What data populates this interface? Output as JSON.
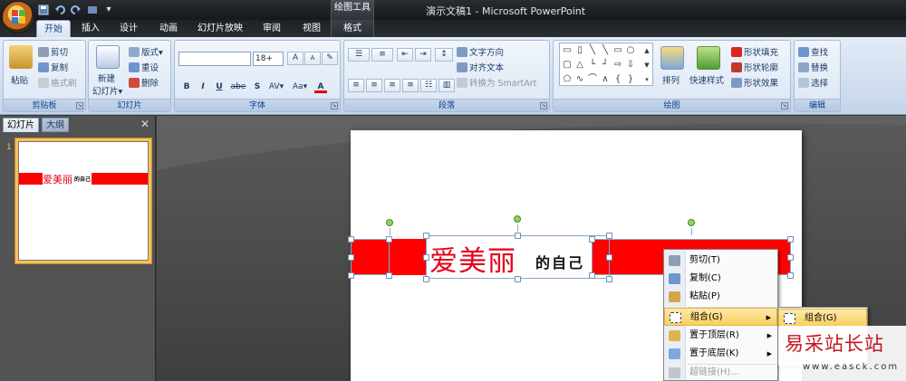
{
  "titlebar": {
    "app_title": "演示文稿1 - Microsoft PowerPoint",
    "context_tool": "绘图工具",
    "qat_icons": [
      "save-icon",
      "undo-icon",
      "redo-icon",
      "customize-icon"
    ],
    "qat_more": "▾"
  },
  "tabs": [
    "开始",
    "插入",
    "设计",
    "动画",
    "幻灯片放映",
    "审阅",
    "视图"
  ],
  "context_tab": "格式",
  "ribbon": {
    "clipboard": {
      "label": "剪贴板",
      "paste": "粘贴",
      "cut": "剪切",
      "copy": "复制",
      "format_painter": "格式刷"
    },
    "slides": {
      "label": "幻灯片",
      "new_slide_1": "新建",
      "new_slide_2": "幻灯片▾",
      "layout": "版式▾",
      "reset": "重设",
      "delete": "删除"
    },
    "font": {
      "label": "字体",
      "font_name": "",
      "font_size": "18+",
      "grow": "A",
      "shrink": "A",
      "bold": "B",
      "italic": "I",
      "underline": "U",
      "strike": "abe",
      "shadow": "S",
      "spacing": "AV▾",
      "case": "Aa▾",
      "color": "A"
    },
    "paragraph": {
      "label": "段落",
      "text_direction": "文字方向",
      "align_text": "对齐文本",
      "smartart": "转换为 SmartArt"
    },
    "drawing": {
      "label": "绘图",
      "arrange": "排列",
      "quick_styles": "快速样式",
      "shape_fill": "形状填充",
      "shape_outline": "形状轮廓",
      "shape_effects": "形状效果"
    },
    "editing": {
      "label": "编辑",
      "find": "查找",
      "replace": "替换",
      "select": "选择"
    }
  },
  "left_panel": {
    "tab_slides": "幻灯片",
    "tab_outline": "大纲",
    "close": "✕",
    "slide_number": "1",
    "thumb_big": "爱美丽",
    "thumb_small": "的自己"
  },
  "slide": {
    "text_big": "爱美丽",
    "text_small": "的自己"
  },
  "context_menu": {
    "items": [
      {
        "label": "剪切(T)",
        "icon": "scissors-icon",
        "arrow": ""
      },
      {
        "label": "复制(C)",
        "icon": "copy-icon",
        "arrow": ""
      },
      {
        "label": "粘贴(P)",
        "icon": "paste-icon",
        "arrow": ""
      },
      {
        "label": "组合(G)",
        "icon": "group-icon",
        "arrow": "▶"
      },
      {
        "label": "置于顶层(R)",
        "icon": "bring-to-front-icon",
        "arrow": "▶"
      },
      {
        "label": "置于底层(K)",
        "icon": "send-to-back-icon",
        "arrow": "▶"
      },
      {
        "label": "超链接(H)...",
        "icon": "hyperlink-icon",
        "arrow": ""
      }
    ]
  },
  "submenu": {
    "items": [
      {
        "label": "组合(G)",
        "icon": "group-icon"
      },
      {
        "label": "",
        "icon": "regroup-icon"
      },
      {
        "label": "",
        "icon": "ungroup-icon"
      }
    ]
  },
  "watermark": {
    "title": "易采站长站",
    "url": "www.easck.com"
  },
  "colors": {
    "accent_red": "#ff0000",
    "text_red": "#e4001a",
    "menu_highlight": "#f8cf5f"
  }
}
